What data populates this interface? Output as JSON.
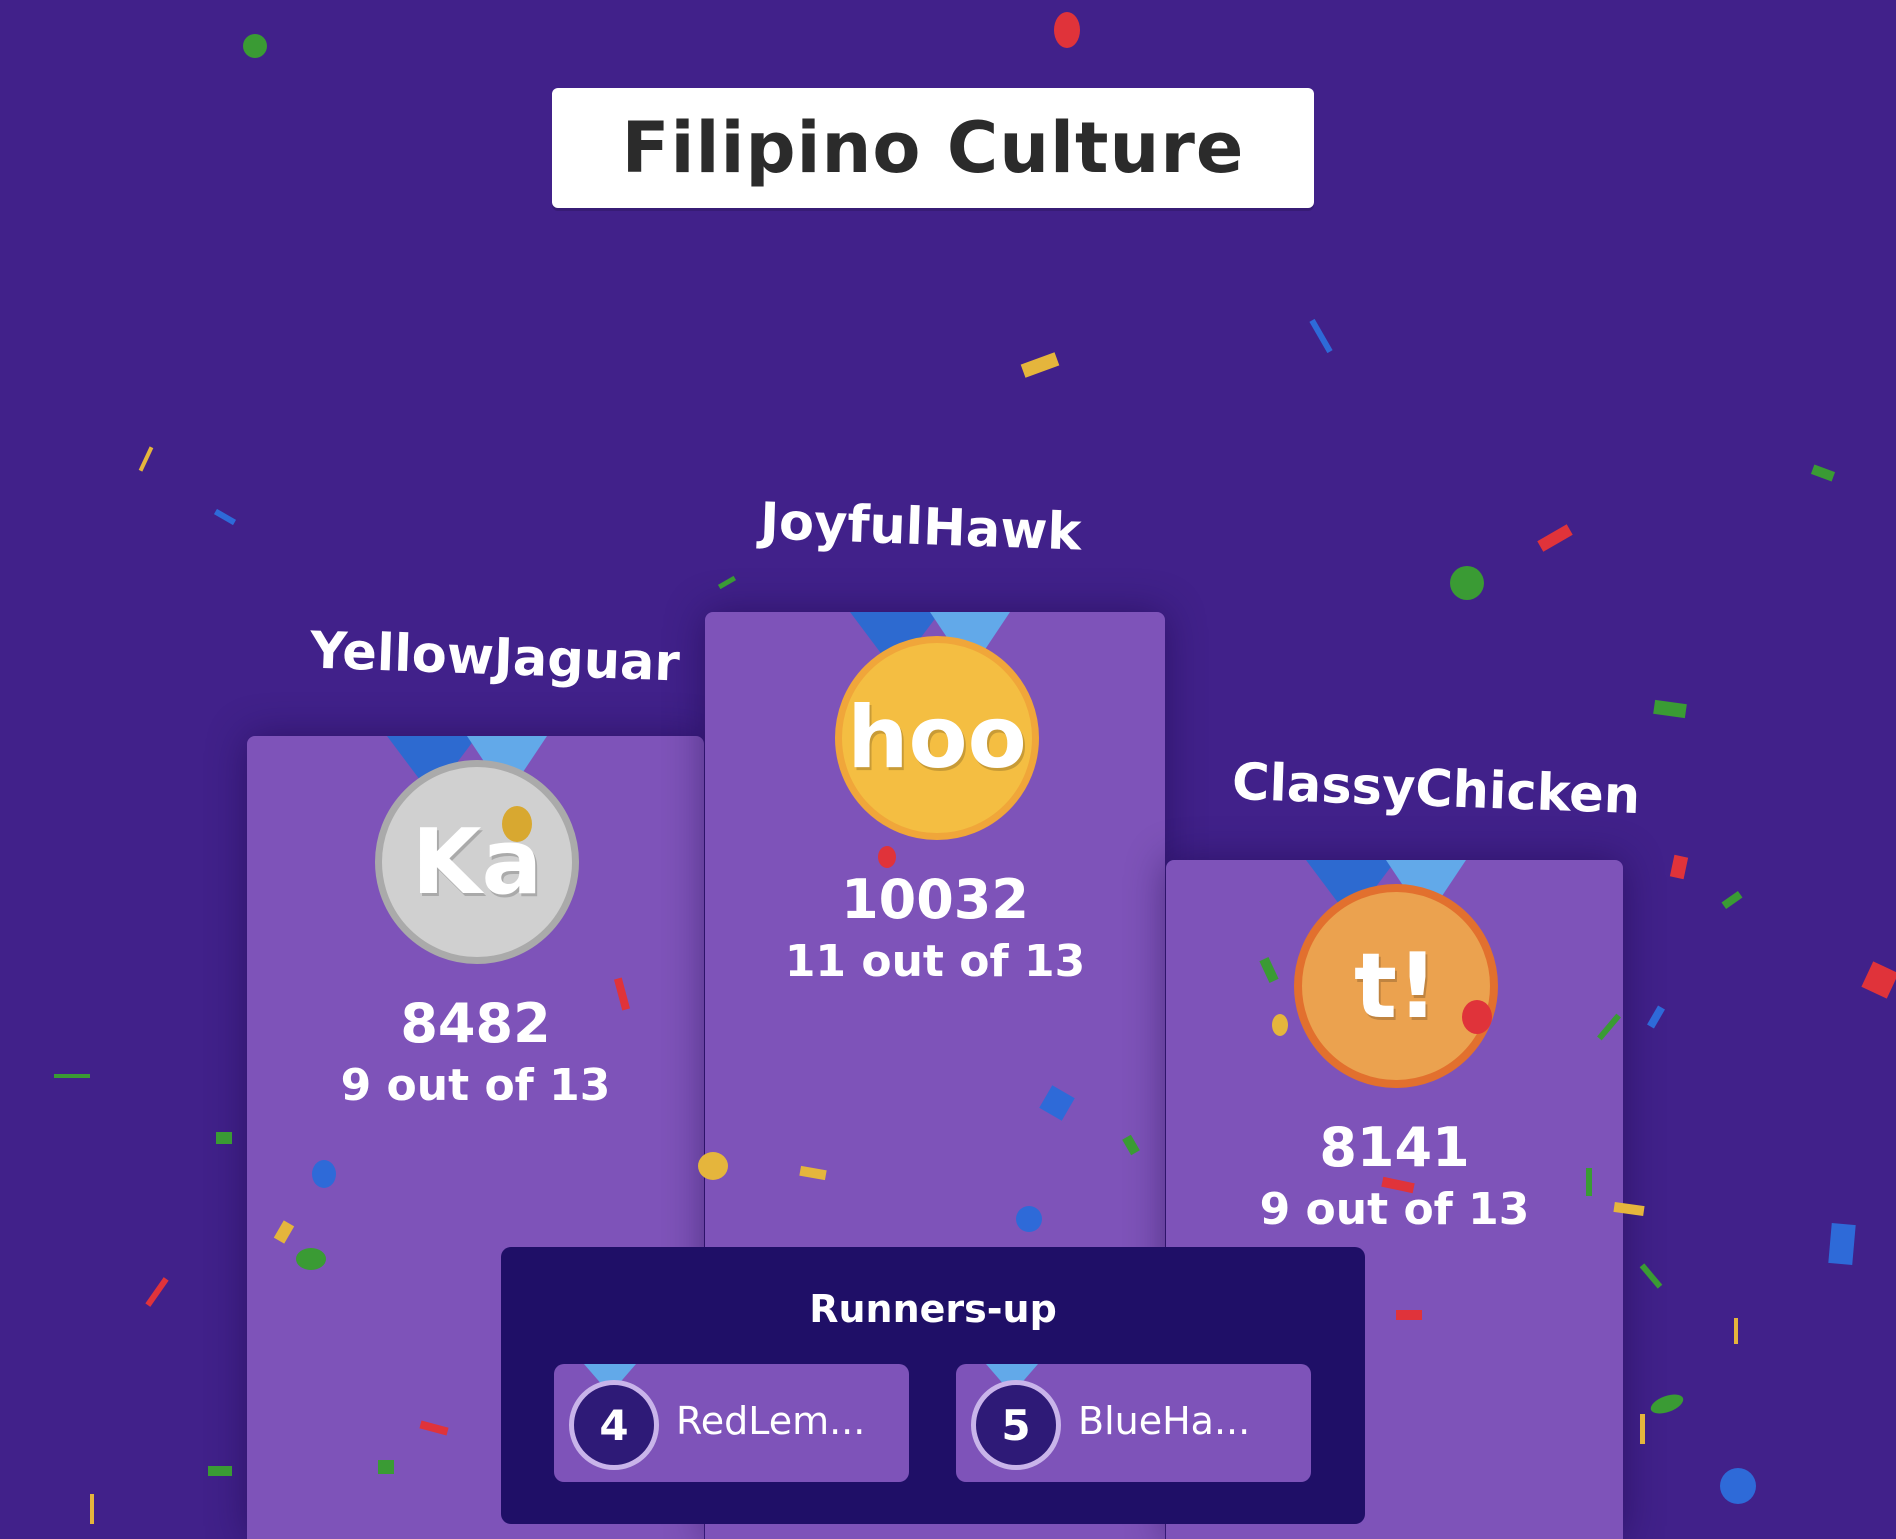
{
  "quiz": {
    "title": "Filipino Culture"
  },
  "podium": {
    "first": {
      "name": "JoyfulHawk",
      "badge": "hoo",
      "score": "10032",
      "correct": "11 out of 13"
    },
    "second": {
      "name": "YellowJaguar",
      "badge": "Ka",
      "score": "8482",
      "correct": "9 out of 13"
    },
    "third": {
      "name": "ClassyChicken",
      "badge": "t!",
      "score": "8141",
      "correct": "9 out of 13"
    }
  },
  "runners_up": {
    "title": "Runners-up",
    "items": [
      {
        "rank": "4",
        "name": "RedLem..."
      },
      {
        "rank": "5",
        "name": "BlueHa..."
      }
    ]
  },
  "colors": {
    "background": "#41218a",
    "podium": "#7e53b9",
    "runners_panel": "#1f0f67",
    "gold_medal": "#f4be42",
    "silver_medal": "#d0d0d0",
    "bronze_medal": "#eba24f"
  }
}
